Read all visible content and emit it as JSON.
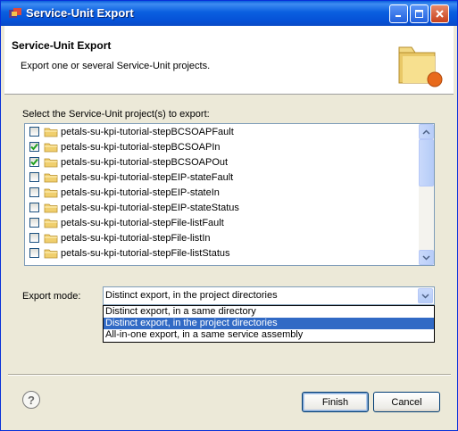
{
  "window": {
    "title": "Service-Unit Export",
    "controls": [
      "minimize-icon",
      "maximize-icon",
      "close-icon"
    ]
  },
  "header": {
    "title": "Service-Unit Export",
    "description": "Export one or several Service-Unit projects."
  },
  "projects": {
    "label": "Select the Service-Unit project(s) to export:",
    "items": [
      {
        "name": "petals-su-kpi-tutorial-stepBCSOAPFault",
        "checked": false
      },
      {
        "name": "petals-su-kpi-tutorial-stepBCSOAPIn",
        "checked": true
      },
      {
        "name": "petals-su-kpi-tutorial-stepBCSOAPOut",
        "checked": true
      },
      {
        "name": "petals-su-kpi-tutorial-stepEIP-stateFault",
        "checked": false
      },
      {
        "name": "petals-su-kpi-tutorial-stepEIP-stateIn",
        "checked": false
      },
      {
        "name": "petals-su-kpi-tutorial-stepEIP-stateStatus",
        "checked": false
      },
      {
        "name": "petals-su-kpi-tutorial-stepFile-listFault",
        "checked": false
      },
      {
        "name": "petals-su-kpi-tutorial-stepFile-listIn",
        "checked": false
      },
      {
        "name": "petals-su-kpi-tutorial-stepFile-listStatus",
        "checked": false
      }
    ]
  },
  "export_mode": {
    "label": "Export mode:",
    "selected": "Distinct export, in the project directories",
    "options": [
      "Distinct export, in a same directory",
      "Distinct export, in the project directories",
      "All-in-one export, in a same service assembly"
    ],
    "highlighted_index": 1
  },
  "footer": {
    "help_symbol": "?",
    "finish_label": "Finish",
    "cancel_label": "Cancel"
  },
  "colors": {
    "titlebar": "#0a5fdc",
    "selection": "#316ac5",
    "dialog_bg": "#ece9d8",
    "check": "#21a121"
  }
}
